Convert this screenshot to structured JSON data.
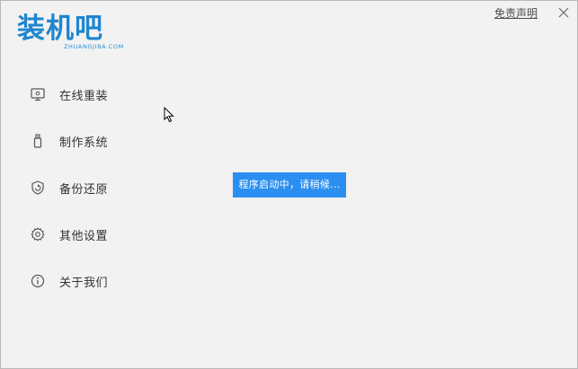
{
  "app": {
    "logo_text": "装机吧",
    "logo_subtext": "ZHUANGJIBA.COM",
    "brand_color": "#1f86cf"
  },
  "header": {
    "disclaimer_label": "免责声明",
    "close_icon": "close-icon"
  },
  "sidebar": {
    "items": [
      {
        "label": "在线重装",
        "icon": "monitor-icon"
      },
      {
        "label": "制作系统",
        "icon": "usb-drive-icon"
      },
      {
        "label": "备份还原",
        "icon": "backup-restore-icon"
      },
      {
        "label": "其他设置",
        "icon": "gear-icon"
      },
      {
        "label": "关于我们",
        "icon": "info-icon"
      }
    ]
  },
  "status": {
    "message": "程序启动中，请稍候...",
    "color": "#2a8ff0"
  }
}
